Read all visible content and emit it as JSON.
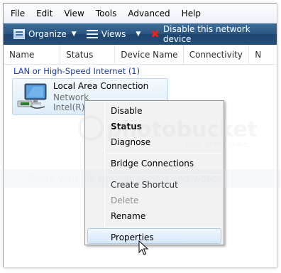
{
  "menubar": {
    "items": [
      "File",
      "Edit",
      "View",
      "Tools",
      "Advanced",
      "Help"
    ]
  },
  "toolbar": {
    "organize_label": "Organize",
    "views_label": "Views",
    "disable_label": "Disable this network device"
  },
  "columns": [
    "Name",
    "Status",
    "Device Name",
    "Connectivity",
    "N"
  ],
  "group_header": "LAN or High-Speed Internet (1)",
  "connection": {
    "name": "Local Area Connection",
    "status": "Network",
    "device": "Intel(R) P"
  },
  "context_menu": {
    "items": [
      {
        "label": "Disable",
        "state": "normal"
      },
      {
        "label": "Status",
        "state": "bold"
      },
      {
        "label": "Diagnose",
        "state": "normal"
      },
      {
        "label": "Bridge Connections",
        "state": "normal"
      },
      {
        "label": "Create Shortcut",
        "state": "normal"
      },
      {
        "label": "Delete",
        "state": "disabled"
      },
      {
        "label": "Rename",
        "state": "normal"
      },
      {
        "label": "Properties",
        "state": "highlighted"
      }
    ]
  },
  "watermark": {
    "text": "photobucket",
    "subtext": "host. store. share.",
    "caption": "Share your life through photos and videos"
  },
  "colors": {
    "toolbar_bg": "#244e79",
    "group_header": "#1e3f9c",
    "selection": "#dcecf9",
    "disable_x": "#e8221d"
  }
}
